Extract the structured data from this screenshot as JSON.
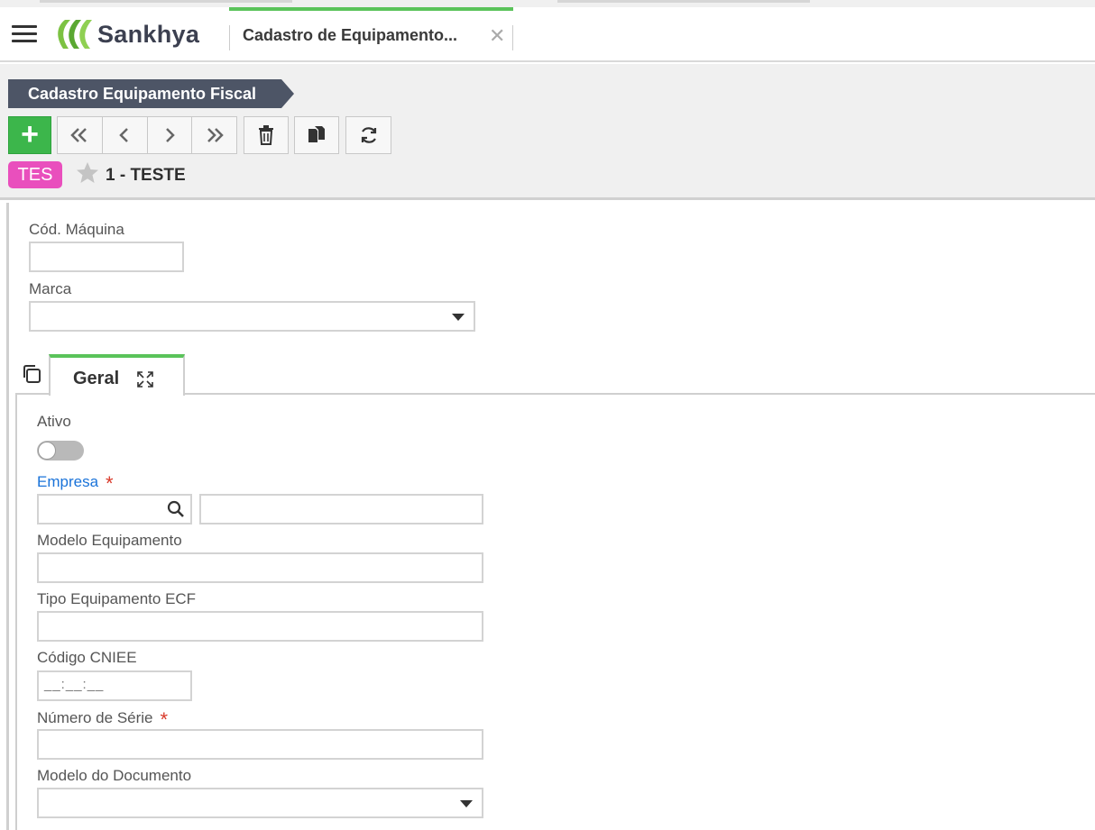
{
  "header": {
    "brand": "Sankhya",
    "active_tab_title": "Cadastro de Equipamento...",
    "close_glyph": "✕"
  },
  "toolbar": {
    "screen_title": "Cadastro Equipamento Fiscal",
    "add_glyph": "+",
    "icons": [
      "plus-icon",
      "first-icon",
      "previous-icon",
      "next-icon",
      "last-icon",
      "trash-icon",
      "duplicate-icon",
      "refresh-icon"
    ]
  },
  "record": {
    "tag": "TES",
    "title": "1 - TESTE"
  },
  "form_top": {
    "cod_maquina_label": "Cód. Máquina",
    "cod_maquina_value": "",
    "marca_label": "Marca",
    "marca_value": ""
  },
  "tabs": [
    {
      "label": "Geral"
    }
  ],
  "geral": {
    "ativo_label": "Ativo",
    "ativo_on": false,
    "empresa_label": "Empresa",
    "empresa_code": "",
    "empresa_name": "",
    "modelo_equipamento_label": "Modelo Equipamento",
    "modelo_equipamento_value": "",
    "tipo_equipamento_label": "Tipo Equipamento ECF",
    "tipo_equipamento_value": "",
    "codigo_cniee_label": "Código CNIEE",
    "codigo_cniee_mask": "__:__:__",
    "numero_serie_label": "Número de Série",
    "numero_serie_value": "",
    "modelo_documento_label": "Modelo do Documento",
    "modelo_documento_value": "",
    "required_marker": "*"
  },
  "colors": {
    "accent_green": "#5ac35a",
    "add_button": "#3cb64b",
    "ribbon": "#4d5566",
    "tag": "#e94fbd",
    "required": "#d93a2b",
    "link_label": "#1a73d9"
  }
}
